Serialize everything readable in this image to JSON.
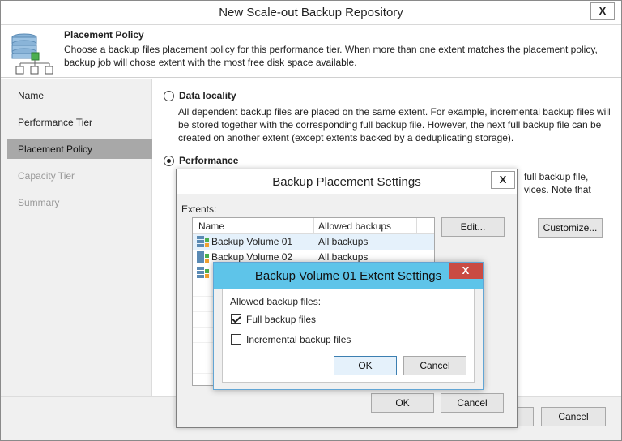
{
  "window": {
    "title": "New Scale-out Backup Repository",
    "close_label": "X"
  },
  "header": {
    "title": "Placement Policy",
    "description": "Choose a backup files placement policy for this performance tier. When more than one extent matches the placement policy, backup job will chose extent with the most free disk space available."
  },
  "sidebar": {
    "items": [
      {
        "label": "Name"
      },
      {
        "label": "Performance Tier"
      },
      {
        "label": "Placement Policy"
      },
      {
        "label": "Capacity Tier"
      },
      {
        "label": "Summary"
      }
    ]
  },
  "content": {
    "data_locality": {
      "label": "Data locality",
      "description": "All dependent backup files are placed on the same extent. For example, incremental backup files will be stored together with the corresponding full backup file. However, the next full backup file can be created on another extent (except extents backed by a deduplicating storage)."
    },
    "performance": {
      "label": "Performance",
      "desc_line1": "full backup file,",
      "desc_line2": "vices. Note that"
    },
    "customize_label": "Customize..."
  },
  "footer": {
    "cancel_label": "Cancel"
  },
  "placement_dialog": {
    "title": "Backup Placement Settings",
    "close_label": "X",
    "extents_label": "Extents:",
    "columns": [
      "Name",
      "Allowed backups"
    ],
    "rows": [
      {
        "name": "Backup Volume 01",
        "allowed": "All backups"
      },
      {
        "name": "Backup Volume 02",
        "allowed": "All backups"
      }
    ],
    "edit_label": "Edit...",
    "ok_label": "OK",
    "cancel_label": "Cancel"
  },
  "extent_dialog": {
    "title": "Backup Volume 01 Extent Settings",
    "close_label": "X",
    "allowed_label": "Allowed backup files:",
    "full_label": "Full backup files",
    "incremental_label": "Incremental backup files",
    "full_checked": true,
    "incremental_checked": false,
    "ok_label": "OK",
    "cancel_label": "Cancel",
    "titlebar_color": "#5ec4e9"
  }
}
